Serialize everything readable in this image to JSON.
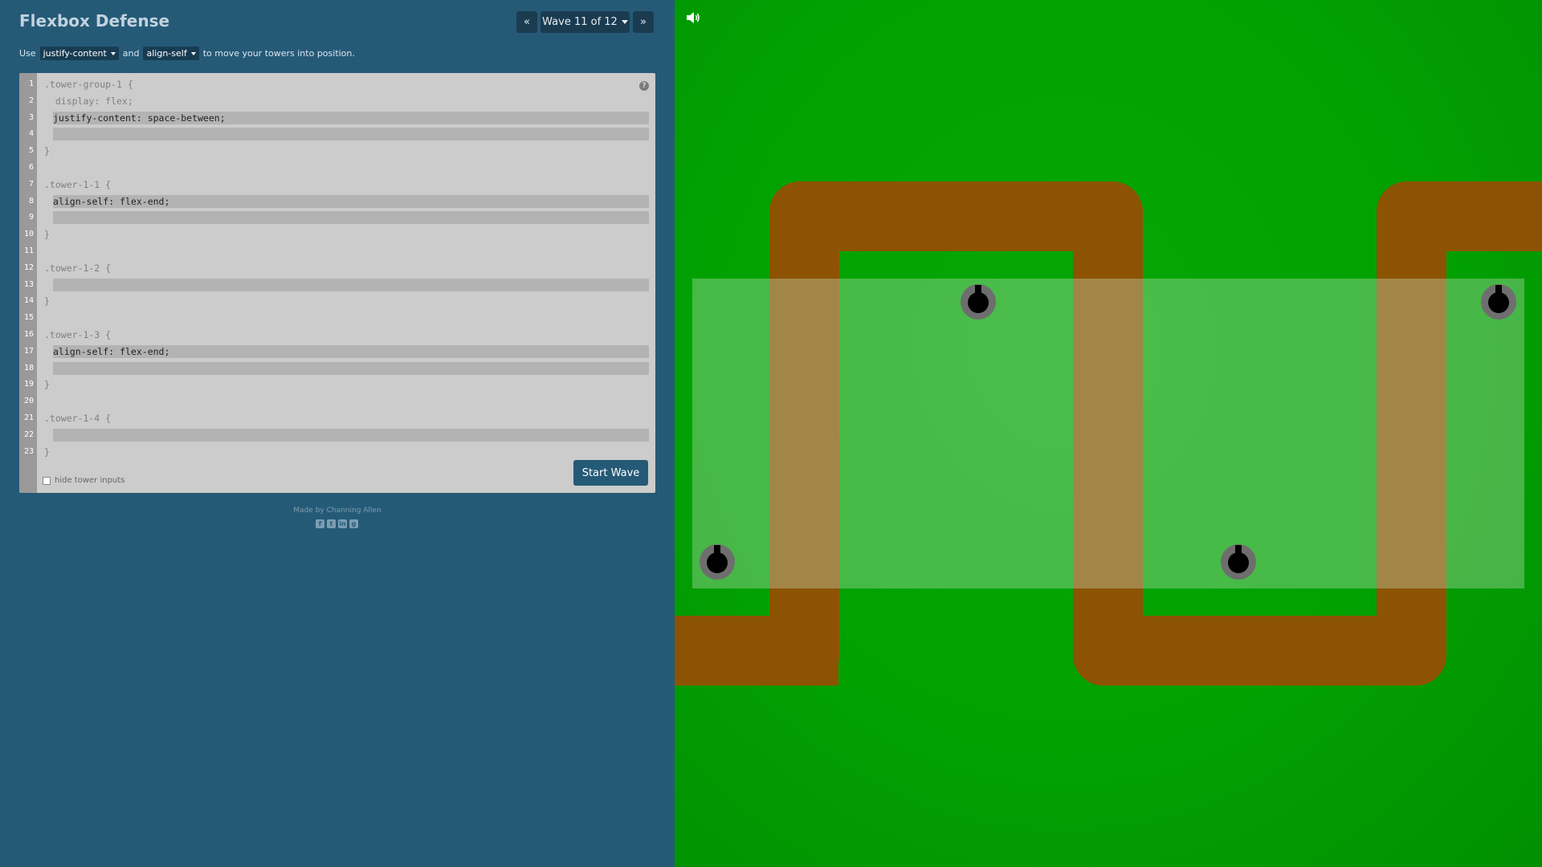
{
  "app": {
    "title": "Flexbox Defense"
  },
  "wave_nav": {
    "prev_icon": "«",
    "label": "Wave 11 of 12",
    "next_icon": "»"
  },
  "instructions": {
    "prefix": "Use",
    "select1": "justify-content",
    "conj": "and",
    "select2": "align-self",
    "suffix": "to move your towers into position."
  },
  "editor": {
    "lines": [
      {
        "n": "1",
        "text": ".tower-group-1 {"
      },
      {
        "n": "2",
        "text": "  display: flex;"
      },
      {
        "n": "3",
        "input": "justify-content: space-between;"
      },
      {
        "n": "4",
        "input": ""
      },
      {
        "n": "5",
        "text": "}"
      },
      {
        "n": "6",
        "text": ""
      },
      {
        "n": "7",
        "text": ".tower-1-1 {"
      },
      {
        "n": "8",
        "input": "align-self: flex-end;"
      },
      {
        "n": "9",
        "input": ""
      },
      {
        "n": "10",
        "text": "}"
      },
      {
        "n": "11",
        "text": ""
      },
      {
        "n": "12",
        "text": ".tower-1-2 {"
      },
      {
        "n": "13",
        "input": ""
      },
      {
        "n": "14",
        "text": "}"
      },
      {
        "n": "15",
        "text": ""
      },
      {
        "n": "16",
        "text": ".tower-1-3 {"
      },
      {
        "n": "17",
        "input": "align-self: flex-end;"
      },
      {
        "n": "18",
        "input": ""
      },
      {
        "n": "19",
        "text": "}"
      },
      {
        "n": "20",
        "text": ""
      },
      {
        "n": "21",
        "text": ".tower-1-4 {"
      },
      {
        "n": "22",
        "input": ""
      },
      {
        "n": "23",
        "text": "}"
      }
    ],
    "help_icon": "?",
    "start_button": "Start Wave",
    "hide_label": "hide tower inputs"
  },
  "footer": {
    "credit": "Made by Channing Allen"
  },
  "icons": [
    "sound-icon",
    "help-icon",
    "facebook-icon",
    "twitter-icon",
    "linkedin-icon",
    "github-icon"
  ],
  "colors": {
    "panel": "#255a77",
    "grass": "#02a102",
    "path": "#8c5304",
    "button": "#255a77"
  }
}
